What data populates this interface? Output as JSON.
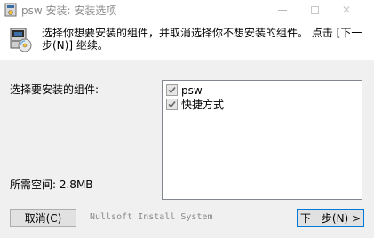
{
  "window": {
    "title": "psw 安装: 安装选项",
    "close_glyph": "✕"
  },
  "header": {
    "instruction": "选择你想要安装的组件，并取消选择你不想安装的组件。 点击 [下一步(N)] 继续。"
  },
  "body": {
    "select_label": "选择要安装的组件:",
    "space_label": "所需空间: 2.8MB",
    "components": [
      {
        "label": "psw",
        "checked": true
      },
      {
        "label": "快捷方式",
        "checked": true
      }
    ]
  },
  "footer": {
    "brand": "Nullsoft Install System",
    "cancel_label": "取消(C)",
    "next_label": "下一步(N) >"
  },
  "icons": {
    "app": "installer-icon",
    "header": "installer-package-icon"
  }
}
